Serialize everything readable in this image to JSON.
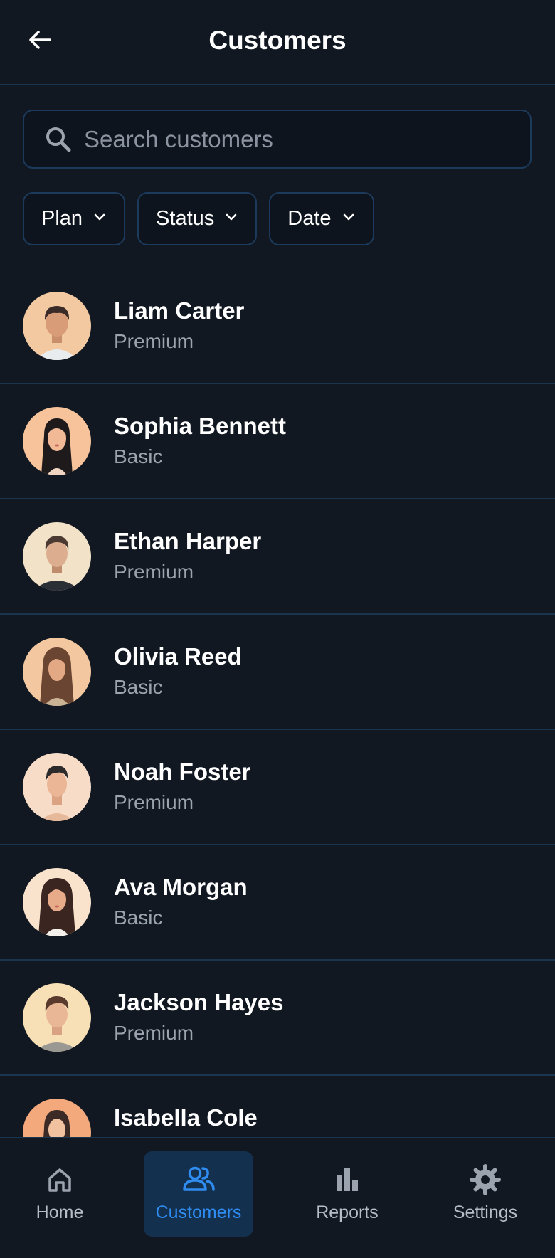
{
  "header": {
    "title": "Customers"
  },
  "search": {
    "placeholder": "Search customers",
    "value": ""
  },
  "filters": [
    {
      "label": "Plan"
    },
    {
      "label": "Status"
    },
    {
      "label": "Date"
    }
  ],
  "customers": [
    {
      "name": "Liam Carter",
      "plan": "Premium"
    },
    {
      "name": "Sophia Bennett",
      "plan": "Basic"
    },
    {
      "name": "Ethan Harper",
      "plan": "Premium"
    },
    {
      "name": "Olivia Reed",
      "plan": "Basic"
    },
    {
      "name": "Noah Foster",
      "plan": "Premium"
    },
    {
      "name": "Ava Morgan",
      "plan": "Basic"
    },
    {
      "name": "Jackson Hayes",
      "plan": "Premium"
    },
    {
      "name": "Isabella Cole",
      "plan": ""
    }
  ],
  "nav": {
    "items": [
      {
        "label": "Home",
        "icon": "home-icon",
        "active": false
      },
      {
        "label": "Customers",
        "icon": "users-icon",
        "active": true
      },
      {
        "label": "Reports",
        "icon": "bar-chart-icon",
        "active": false
      },
      {
        "label": "Settings",
        "icon": "gear-icon",
        "active": false
      }
    ]
  },
  "colors": {
    "background": "#111822",
    "divider": "#1a3550",
    "accent": "#2f8cf0",
    "active_nav_bg": "#13304f",
    "muted_text": "#9aa3ae"
  }
}
